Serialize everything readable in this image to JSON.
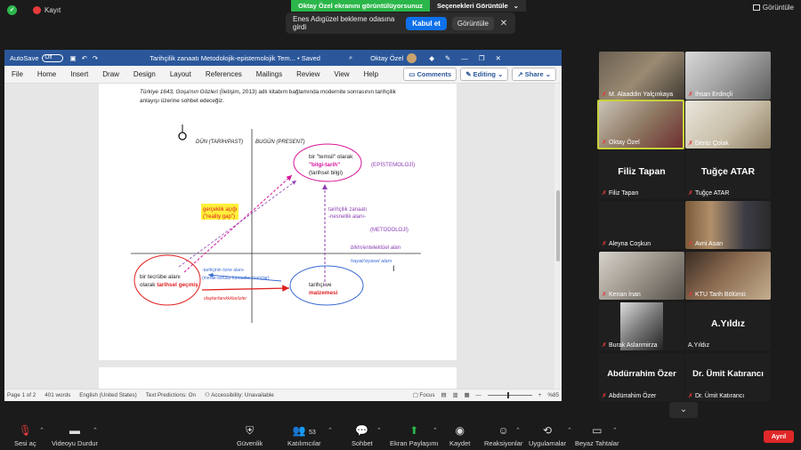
{
  "top": {
    "recording_label": "Kayıt",
    "sharing_banner": "Oktay Özel ekranını görüntülüyorsunuz",
    "view_options": "Seçenekleri Görüntüle",
    "view_label": "Görüntüle"
  },
  "notification": {
    "message": "Enes Adıgüzel bekleme odasına girdi",
    "accept": "Kabul et",
    "see": "Görüntüle"
  },
  "word": {
    "autosave": "AutoSave",
    "autosave_state": "Off",
    "doc_title": "Tarihçilik zanaatı Metodolojik-epistemolojik Tem... • Saved",
    "user": "Oktay Özel",
    "menu": [
      "File",
      "Home",
      "Insert",
      "Draw",
      "Design",
      "Layout",
      "References",
      "Mailings",
      "Review",
      "View",
      "Help"
    ],
    "comments": "Comments",
    "editing": "Editing",
    "share": "Share",
    "status": {
      "page": "Page 1 of 2",
      "words": "401 words",
      "language": "English (United States)",
      "predictions": "Text Predictions: On",
      "accessibility": "Accessibility: Unavailable",
      "focus": "Focus",
      "zoom": "%85"
    }
  },
  "document": {
    "intro_italic": "Türkiye 1643, Goşa'nın Gözleri",
    "intro_rest": " (İletişim, 2013) adlı kitabım bağlamında modernite sonrasının tarihçilik",
    "intro_line2": "anlayışı üzerine sohbet edeceğiz.",
    "label_past": "DÜN (TARİH/PAST)",
    "label_present": "BUGÜN (PRESENT)",
    "top_ellipse_l1": "bir \"temsil\" olarak",
    "top_ellipse_l2": "\"bilgi-tarih\"",
    "top_ellipse_l3": "(tarihsel bilgi)",
    "epistemoloji": "(EPİSTEMOLOJİ)",
    "gap_l1": "gerçeklik açığı",
    "gap_l2": "(\"reality gap\")",
    "craft_l1": "tarihçilik zanaatı",
    "craft_l2": "-nesnellik alanı-",
    "metodoloji": "(METODOLOJİ)",
    "bilim_alan": "bilim/entelektüel alan",
    "hayat_alan": "hayat/siyaset alanı",
    "left_ellipse_l1": "bir tecrübe alanı",
    "left_ellipse_l2a": "olarak ",
    "left_ellipse_l2b": "tarihsel geçmiş",
    "zone_l1": "-tarihçinin özne alanı-",
    "zone_l2": "(merak-sorular-kanaatler-inançlar)",
    "olaylar": "olaylar/tanıklıklar/izler",
    "right_ellipse_l1": "tarihçi ve",
    "right_ellipse_l2": "malzemesi"
  },
  "participants": [
    {
      "name": "M. Alaaddin Yalçınkaya",
      "video": true
    },
    {
      "name": "İhsan Erdinçli",
      "video": true
    },
    {
      "name": "Oktay Özel",
      "video": true,
      "active": true
    },
    {
      "name": "Deniz Çolak",
      "video": true
    },
    {
      "name": "Filiz Tapan",
      "big": "Filiz Tapan"
    },
    {
      "name": "Tuğçe ATAR",
      "big": "Tuğçe ATAR"
    },
    {
      "name": "Aleyna Coşkun",
      "big": ""
    },
    {
      "name": "Avni Asan",
      "video": true
    },
    {
      "name": "Kenan İnan",
      "video": true
    },
    {
      "name": "KTU Tarih Bölümü",
      "video": true
    },
    {
      "name": "Burak Aslanmirza",
      "video": true
    },
    {
      "name": "A.Yıldız",
      "big": "A.Yıldız"
    },
    {
      "name": "Abdürrahim Özer",
      "big": "Abdürrahim Özer"
    },
    {
      "name": "Dr. Ümit Katırancı",
      "big": "Dr. Ümit Katırancı"
    }
  ],
  "toolbar": {
    "mute": "Sesi aç",
    "video": "Videoyu Durdur",
    "security": "Güvenlik",
    "participants": "Katılımcılar",
    "participants_count": "53",
    "chat": "Sohbet",
    "share": "Ekran Paylaşımı",
    "record": "Kaydet",
    "reactions": "Reaksiyonlar",
    "apps": "Uygulamalar",
    "whiteboard": "Beyaz Tahtalar",
    "leave": "Ayrıl"
  },
  "colors": {
    "zoom_green": "#2bb64a",
    "word_blue": "#2b579a",
    "accept_blue": "#0e71eb",
    "leave_red": "#e02828",
    "active_border": "#c7d13b",
    "magenta": "#d6159a",
    "red": "#e02020",
    "blue_ellipse": "#3a6ad4",
    "purple": "#8c3fb5",
    "yellow": "#ffef3a"
  }
}
